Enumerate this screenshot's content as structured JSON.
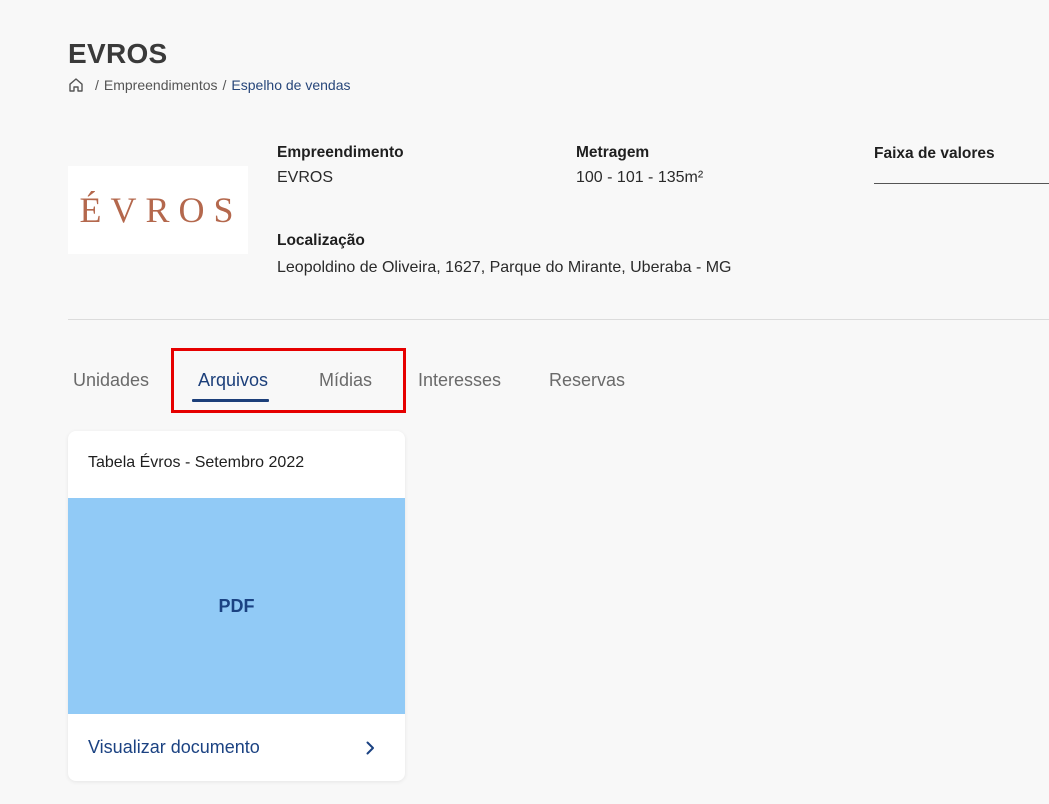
{
  "page": {
    "title": "EVROS"
  },
  "breadcrumb": {
    "home_icon": "home-icon",
    "separator": "/",
    "items": [
      "Empreendimentos",
      "Espelho de vendas"
    ]
  },
  "logo": {
    "text": "ÉVROS"
  },
  "info": {
    "empreendimento": {
      "label": "Empreendimento",
      "value": "EVROS"
    },
    "metragem": {
      "label": "Metragem",
      "value": "100 - 101 - 135m²"
    },
    "faixa": {
      "label": "Faixa de valores",
      "value": ""
    },
    "localizacao": {
      "label": "Localização",
      "value": "Leopoldino de Oliveira, 1627, Parque do Mirante, Uberaba - MG"
    }
  },
  "tabs": [
    {
      "label": "Unidades",
      "active": false
    },
    {
      "label": "Arquivos",
      "active": true
    },
    {
      "label": "Mídias",
      "active": false
    },
    {
      "label": "Interesses",
      "active": false
    },
    {
      "label": "Reservas",
      "active": false
    }
  ],
  "files": [
    {
      "title": "Tabela Évros - Setembro 2022",
      "type_label": "PDF",
      "action_label": "Visualizar documento",
      "action_icon": "chevron-right-icon"
    }
  ],
  "colors": {
    "accent": "#1c3f7a",
    "preview_bg": "#91caf6",
    "logo": "#b4684d",
    "highlight": "#e60000"
  }
}
